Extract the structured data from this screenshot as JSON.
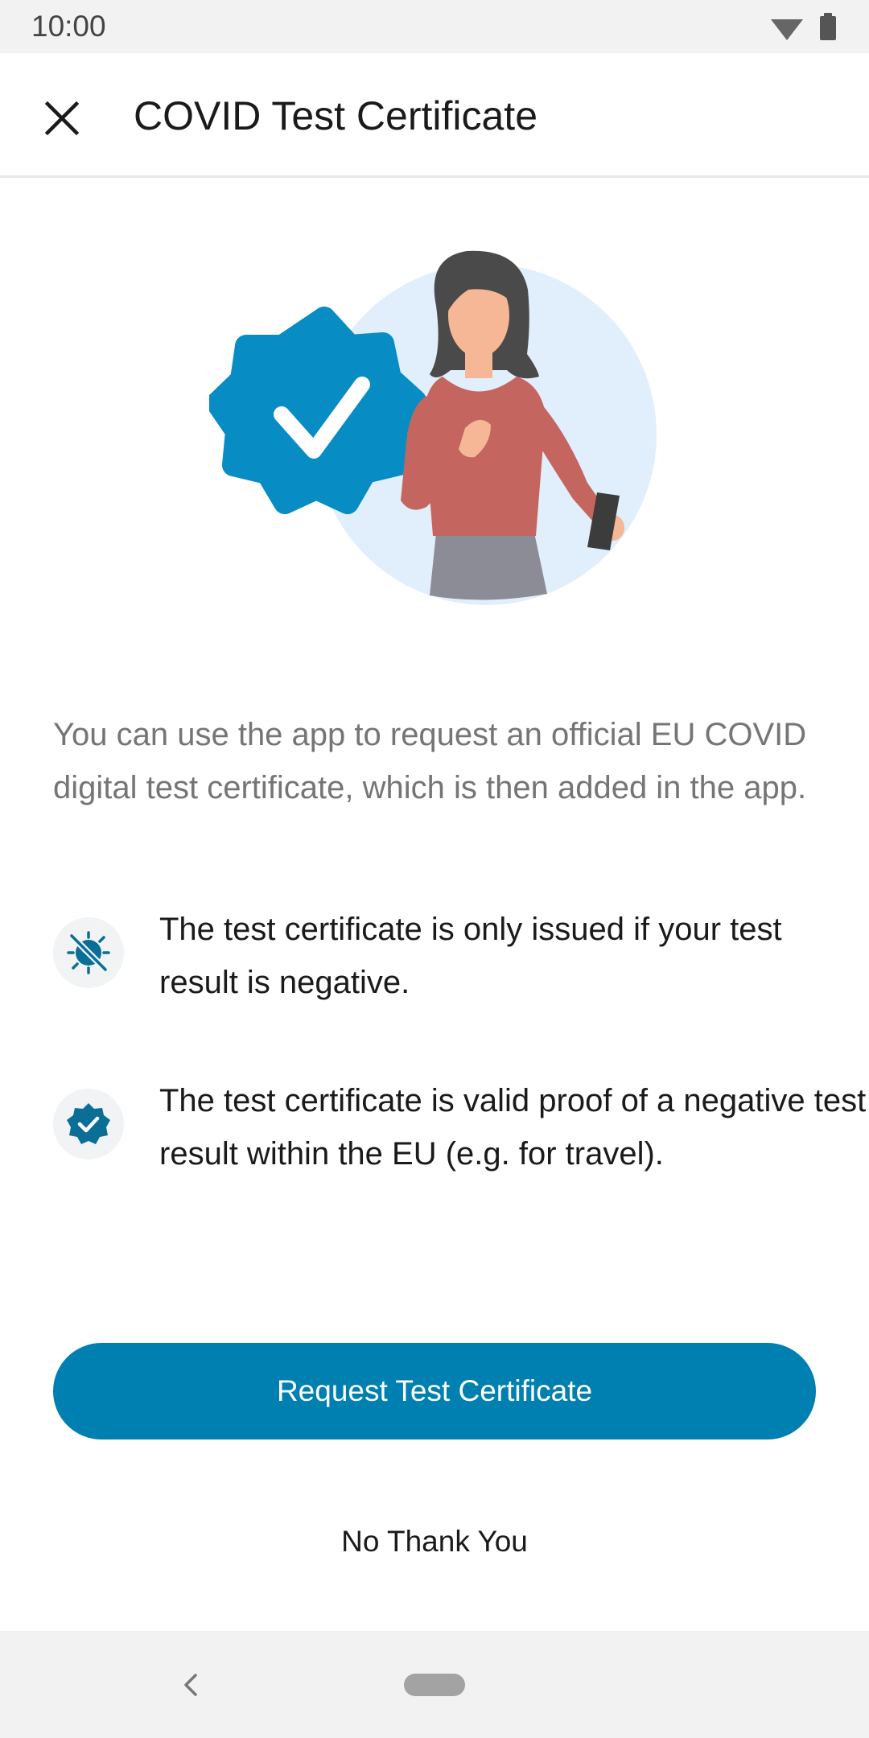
{
  "status_bar": {
    "time": "10:00",
    "icons": [
      "wifi-icon",
      "battery-icon"
    ]
  },
  "app_bar": {
    "close_icon": "close-icon",
    "title": "COVID Test Certificate"
  },
  "hero": {
    "illustration": "woman-with-verified-badge-illustration"
  },
  "content": {
    "intro": "You can use the app to request an official EU COVID digital test certificate, which is then added in the app.",
    "items": [
      {
        "icon": "virus-crossed-icon",
        "text": "The test certificate is only issued if your test result is negative."
      },
      {
        "icon": "verified-badge-icon",
        "text": "The test certificate is valid proof of a negative test result within the EU (e.g. for travel)."
      }
    ]
  },
  "actions": {
    "primary_label": "Request Test Certificate",
    "secondary_label": "No Thank You"
  },
  "navigation": {
    "back_icon": "back-chevron-icon",
    "home_icon": "home-pill-icon"
  },
  "colors": {
    "accent": "#0080b0",
    "badge_blue": "#078cc4",
    "hero_circle": "#e1eefc",
    "shirt": "#c4665f",
    "skin": "#f5b795",
    "hair": "#4a4a4a",
    "skirt": "#8c8c96",
    "secondary_text": "#757575",
    "primary_text": "#1a1a1a",
    "icon_bg": "#f1f3f4"
  }
}
